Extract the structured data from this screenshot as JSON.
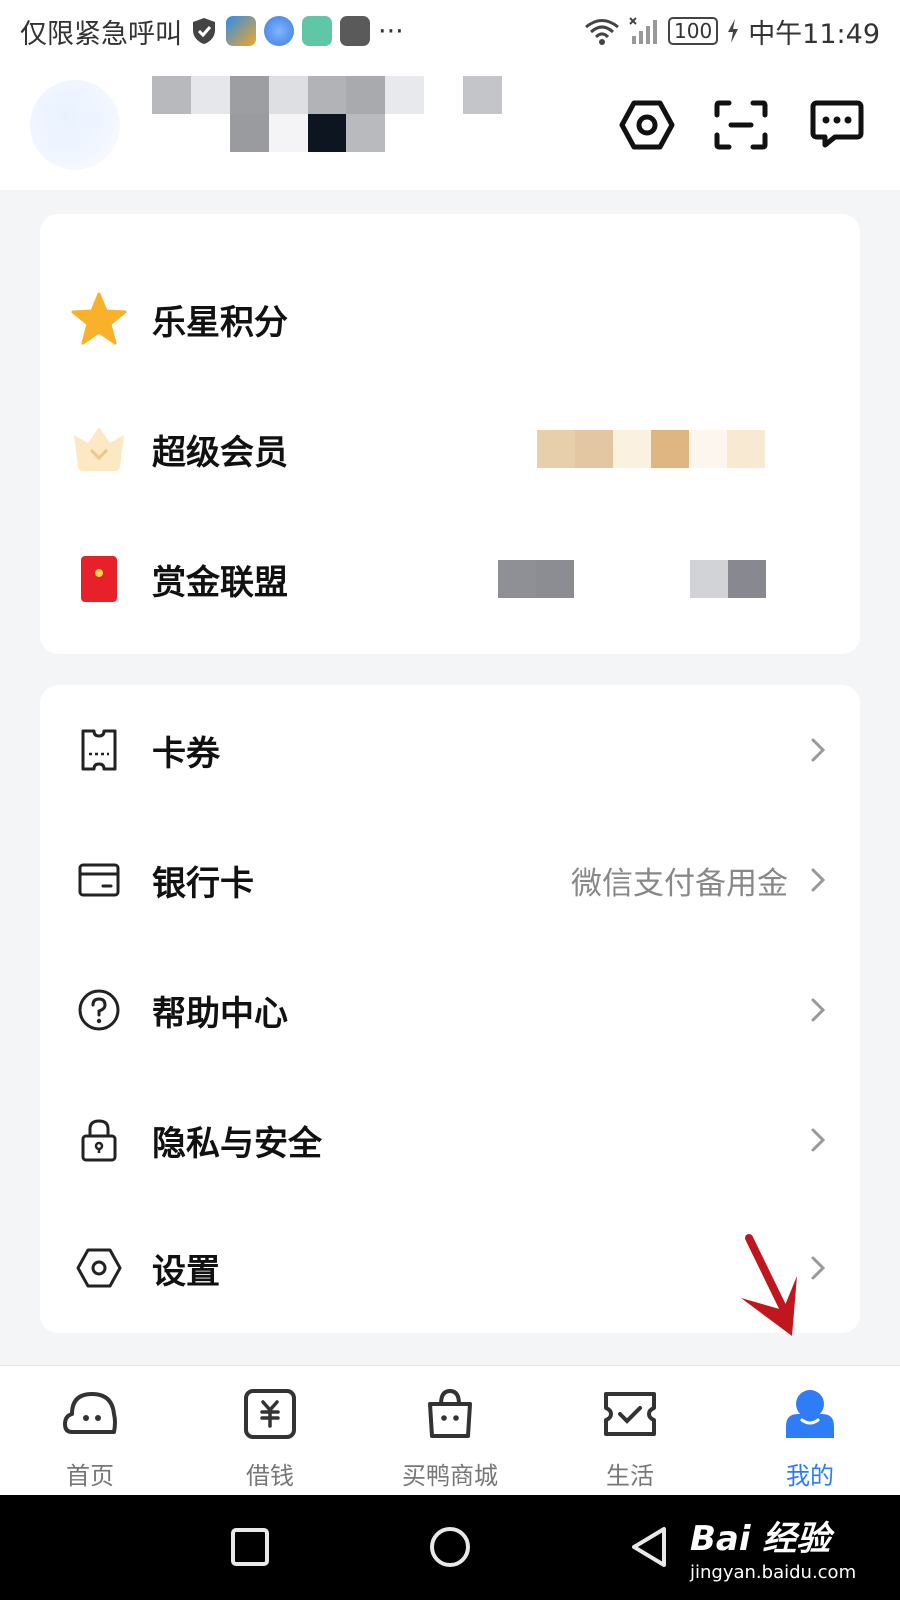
{
  "status_bar": {
    "carrier": "仅限紧急呼叫",
    "more": "···",
    "battery": "100",
    "time": "中午11:49"
  },
  "header": {
    "icons": [
      "settings-hex-icon",
      "scan-icon",
      "message-icon"
    ]
  },
  "card1": {
    "rows": [
      {
        "label": "乐星积分",
        "icon": "star-icon"
      },
      {
        "label": "超级会员",
        "icon": "crown-icon"
      },
      {
        "label": "赏金联盟",
        "icon": "red-envelope-icon"
      }
    ]
  },
  "card2": {
    "rows": [
      {
        "label": "卡券",
        "icon": "ticket-icon",
        "value": ""
      },
      {
        "label": "银行卡",
        "icon": "bank-card-icon",
        "value": "微信支付备用金"
      },
      {
        "label": "帮助中心",
        "icon": "help-icon",
        "value": ""
      },
      {
        "label": "隐私与安全",
        "icon": "lock-icon",
        "value": ""
      },
      {
        "label": "设置",
        "icon": "settings-icon",
        "value": ""
      }
    ]
  },
  "tabbar": {
    "tabs": [
      {
        "label": "首页",
        "icon": "home-cloud-icon"
      },
      {
        "label": "借钱",
        "icon": "yuan-box-icon"
      },
      {
        "label": "买鸭商城",
        "icon": "shopping-bag-icon"
      },
      {
        "label": "生活",
        "icon": "ticket-check-icon"
      },
      {
        "label": "我的",
        "icon": "user-icon",
        "active": true
      }
    ]
  },
  "watermark": {
    "brand": "Bai  经验",
    "url": "jingyan.baidu.com"
  },
  "colors": {
    "accent": "#2f7df6",
    "star": "#f9b12a",
    "red": "#e8202a",
    "arrow": "#c0171e",
    "background": "#f4f5f6"
  }
}
